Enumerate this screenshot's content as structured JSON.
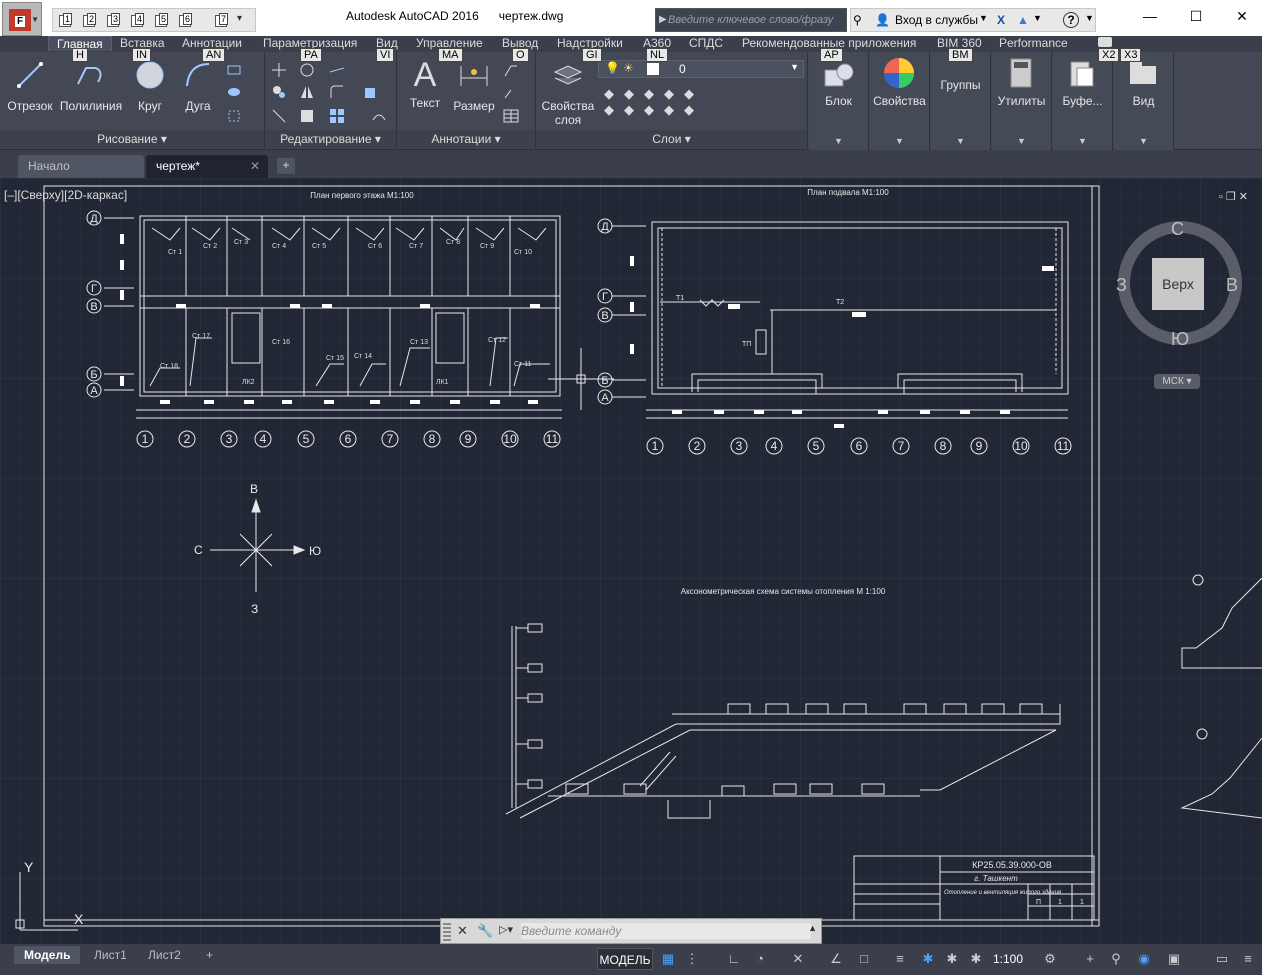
{
  "window": {
    "app_title": "Autodesk AutoCAD 2016",
    "doc_title": "чертеж.dwg",
    "search_placeholder": "Введите ключевое слово/фразу",
    "login_label": "Вход в службы",
    "help_label": "?"
  },
  "app_button": {
    "letter": "A",
    "key": "F"
  },
  "qat_keys": [
    "1",
    "2",
    "3",
    "4",
    "5",
    "6",
    "7"
  ],
  "ribbon_tabs": [
    {
      "label": "Главная",
      "key": "H",
      "active": true
    },
    {
      "label": "Вставка",
      "key": "IN"
    },
    {
      "label": "Аннотации",
      "key": "AN"
    },
    {
      "label": "Параметризация",
      "key": "PA"
    },
    {
      "label": "Вид",
      "key": "VI"
    },
    {
      "label": "Управление",
      "key": "MA"
    },
    {
      "label": "Вывод",
      "key": "O"
    },
    {
      "label": "Надстройки",
      "key": "GI"
    },
    {
      "label": "A360",
      "key": "NL"
    },
    {
      "label": "СПДС",
      "key": ""
    },
    {
      "label": "Рекомендованные приложения",
      "key": "AP"
    },
    {
      "label": "BIM 360",
      "key": "BM"
    },
    {
      "label": "Performance",
      "key": ""
    }
  ],
  "extra_keys": [
    "X2",
    "X3"
  ],
  "panels": {
    "draw": {
      "title": "Рисование",
      "buttons": [
        "Отрезок",
        "Полилиния",
        "Круг",
        "Дуга"
      ]
    },
    "modify": {
      "title": "Редактирование"
    },
    "annotation": {
      "title": "Аннотации",
      "buttons": [
        "Текст",
        "Размер"
      ]
    },
    "layers": {
      "title": "Слои",
      "properties_label": "Свойства слоя",
      "current_layer": "0"
    },
    "block": {
      "label": "Блок"
    },
    "properties": {
      "label": "Свойства"
    },
    "groups": {
      "label": "Группы"
    },
    "utilities": {
      "label": "Утилиты"
    },
    "clipboard": {
      "label": "Буфе..."
    },
    "view": {
      "label": "Вид"
    }
  },
  "doc_tabs": [
    {
      "label": "Начало",
      "active": false
    },
    {
      "label": "чертеж*",
      "active": true
    }
  ],
  "viewport": {
    "label": "[–][Сверху][2D-каркас]",
    "viewcube_face": "Верх",
    "dir_n": "С",
    "dir_s": "Ю",
    "dir_w": "З",
    "dir_e": "В",
    "ucs_label": "МСК"
  },
  "drawing": {
    "plan1_title": "План первого этажа М1:100",
    "plan2_title": "План подвала М1:100",
    "axo_title": "Аксонометрическая схема системы отопления М 1:100",
    "row_axes": [
      "Д",
      "Г",
      "В",
      "Б",
      "А"
    ],
    "col_axes": [
      "1",
      "2",
      "3",
      "4",
      "5",
      "6",
      "7",
      "8",
      "9",
      "10",
      "11"
    ],
    "compass": {
      "n": "В",
      "s": "З",
      "w": "С",
      "e": "Ю"
    },
    "stamp_code": "КР25.05.39.000-ОВ",
    "stamp_city": "г. Ташкент",
    "stamp_desc": "Отопление и вентиляция жилого здания",
    "stamp_sheet": "П",
    "stamp_n1": "1",
    "stamp_n2": "1",
    "room_labels_top": [
      "Ст 1",
      "Ст 2",
      "Ст 3",
      "Ст 4",
      "Ст 5",
      "Ст 6",
      "Ст 7",
      "Ст 8",
      "Ст 9",
      "Ст 10"
    ],
    "room_labels_bottom": [
      "Ст 18",
      "Ст 17",
      "Ст 16",
      "Ст 15",
      "Ст 14",
      "Ст 13",
      "Ст 12",
      "Ст 11"
    ],
    "lk": [
      "ЛК2",
      "ЛК1"
    ],
    "t1": "Т1",
    "t2": "Т2",
    "tp": "ТП",
    "ucs_x": "X",
    "ucs_y": "Y"
  },
  "command_line": {
    "placeholder": "Введите команду"
  },
  "layout_tabs": [
    {
      "label": "Модель",
      "active": true
    },
    {
      "label": "Лист1"
    },
    {
      "label": "Лист2"
    }
  ],
  "status": {
    "model_label": "МОДЕЛЬ",
    "scale": "1:100"
  }
}
